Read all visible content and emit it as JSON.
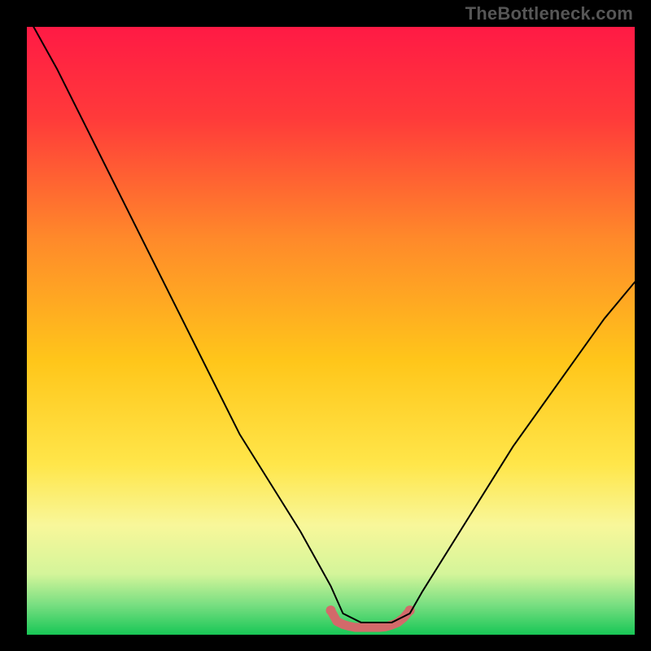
{
  "watermark": "TheBottleneck.com",
  "chart_data": {
    "type": "line",
    "title": "",
    "xlabel": "",
    "ylabel": "",
    "xrange": [
      0,
      100
    ],
    "ylim": [
      0,
      100
    ],
    "gradient_stops": [
      {
        "pct": 0,
        "color": "#ff1a45"
      },
      {
        "pct": 15,
        "color": "#ff3a3a"
      },
      {
        "pct": 35,
        "color": "#ff8a2a"
      },
      {
        "pct": 55,
        "color": "#ffc61a"
      },
      {
        "pct": 72,
        "color": "#ffe64a"
      },
      {
        "pct": 82,
        "color": "#f8f79a"
      },
      {
        "pct": 90,
        "color": "#d4f59a"
      },
      {
        "pct": 95,
        "color": "#7adf82"
      },
      {
        "pct": 100,
        "color": "#18c756"
      }
    ],
    "series": [
      {
        "name": "main-curve",
        "color": "#000000",
        "stroke_width": 2,
        "x": [
          0,
          5,
          10,
          15,
          20,
          25,
          30,
          35,
          40,
          45,
          50,
          52,
          55,
          58,
          60,
          63,
          65,
          70,
          75,
          80,
          85,
          90,
          95,
          100
        ],
        "values": [
          102,
          93,
          83,
          73,
          63,
          53,
          43,
          33,
          25,
          17,
          8,
          3.5,
          2,
          2,
          2,
          3.5,
          7,
          15,
          23,
          31,
          38,
          45,
          52,
          58
        ]
      },
      {
        "name": "bottleneck-band",
        "color": "#d36a6a",
        "stroke_width": 11,
        "x": [
          50,
          51,
          52,
          53,
          54,
          55,
          56,
          57,
          58,
          59,
          60,
          61,
          62,
          63
        ],
        "values": [
          4.0,
          2.2,
          1.7,
          1.4,
          1.2,
          1.2,
          1.2,
          1.2,
          1.2,
          1.3,
          1.6,
          2.0,
          2.8,
          4.0
        ]
      }
    ],
    "bottleneck_endpoints": [
      {
        "x": 50,
        "y": 4.0
      },
      {
        "x": 63,
        "y": 4.0
      }
    ]
  }
}
